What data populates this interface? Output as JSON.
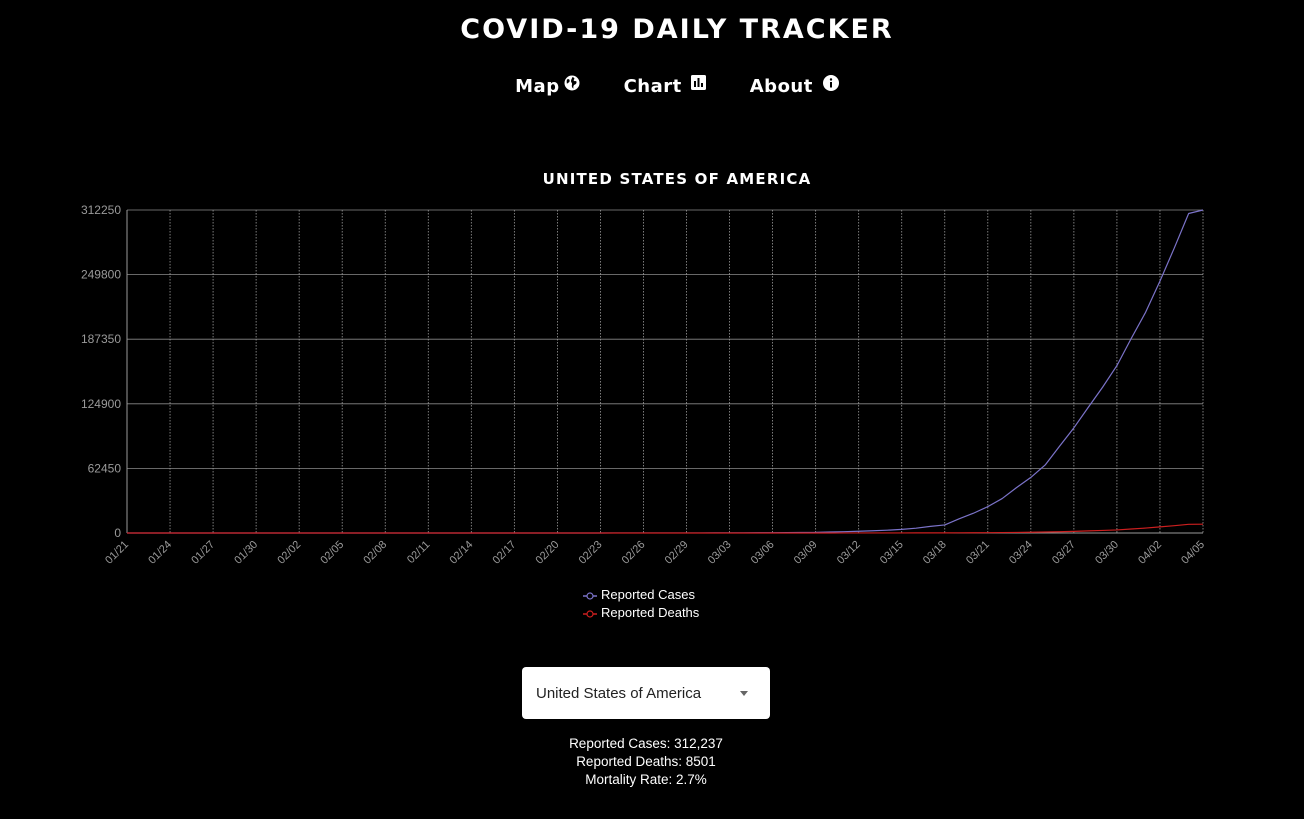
{
  "header": {
    "title": "COVID-19 DAILY TRACKER"
  },
  "nav": {
    "items": [
      {
        "label": "Map",
        "icon": "globe-icon"
      },
      {
        "label": "Chart",
        "icon": "bar-chart-icon"
      },
      {
        "label": "About",
        "icon": "info-icon"
      }
    ]
  },
  "chart_title": "UNITED STATES OF AMERICA",
  "chart_data": {
    "type": "line",
    "title": "UNITED STATES OF AMERICA",
    "xlabel": "",
    "ylabel": "",
    "ylim": [
      0,
      312250
    ],
    "y_ticks": [
      0,
      62450,
      124900,
      187350,
      249800,
      312250
    ],
    "x_tick_labels": [
      "01/21",
      "01/24",
      "01/27",
      "01/30",
      "02/02",
      "02/05",
      "02/08",
      "02/11",
      "02/14",
      "02/17",
      "02/20",
      "02/23",
      "02/26",
      "02/29",
      "03/03",
      "03/06",
      "03/09",
      "03/12",
      "03/15",
      "03/18",
      "03/21",
      "03/24",
      "03/27",
      "03/30",
      "04/02",
      "04/05"
    ],
    "grid": true,
    "legend_placement": "bottom-center",
    "x": [
      "01/21",
      "01/22",
      "01/23",
      "01/24",
      "01/25",
      "01/26",
      "01/27",
      "01/28",
      "01/29",
      "01/30",
      "01/31",
      "02/01",
      "02/02",
      "02/03",
      "02/04",
      "02/05",
      "02/06",
      "02/07",
      "02/08",
      "02/09",
      "02/10",
      "02/11",
      "02/12",
      "02/13",
      "02/14",
      "02/15",
      "02/16",
      "02/17",
      "02/18",
      "02/19",
      "02/20",
      "02/21",
      "02/22",
      "02/23",
      "02/24",
      "02/25",
      "02/26",
      "02/27",
      "02/28",
      "02/29",
      "03/01",
      "03/02",
      "03/03",
      "03/04",
      "03/05",
      "03/06",
      "03/07",
      "03/08",
      "03/09",
      "03/10",
      "03/11",
      "03/12",
      "03/13",
      "03/14",
      "03/15",
      "03/16",
      "03/17",
      "03/18",
      "03/19",
      "03/20",
      "03/21",
      "03/22",
      "03/23",
      "03/24",
      "03/25",
      "03/26",
      "03/27",
      "03/28",
      "03/29",
      "03/30",
      "03/31",
      "04/01",
      "04/02",
      "04/03",
      "04/04",
      "04/05"
    ],
    "series": [
      {
        "name": "Reported Cases",
        "color": "#7b73c9",
        "values": [
          1,
          1,
          1,
          2,
          2,
          5,
          5,
          5,
          5,
          6,
          7,
          8,
          11,
          11,
          11,
          12,
          12,
          12,
          12,
          12,
          13,
          13,
          14,
          14,
          14,
          14,
          14,
          14,
          14,
          14,
          14,
          15,
          15,
          15,
          51,
          51,
          57,
          58,
          60,
          68,
          74,
          98,
          118,
          149,
          217,
          262,
          402,
          518,
          583,
          959,
          1281,
          1663,
          2179,
          2727,
          3499,
          4632,
          6421,
          7786,
          13680,
          19101,
          25493,
          33276,
          43847,
          53740,
          65778,
          83836,
          101657,
          121465,
          140909,
          161831,
          188172,
          213372,
          243453,
          275586,
          308850,
          312237
        ]
      },
      {
        "name": "Reported Deaths",
        "color": "#cc1f1f",
        "values": [
          0,
          0,
          0,
          0,
          0,
          0,
          0,
          0,
          0,
          0,
          0,
          0,
          0,
          0,
          0,
          0,
          0,
          0,
          0,
          0,
          0,
          0,
          0,
          0,
          0,
          0,
          0,
          0,
          0,
          0,
          0,
          0,
          0,
          0,
          0,
          0,
          0,
          0,
          0,
          0,
          1,
          6,
          7,
          11,
          12,
          14,
          17,
          21,
          22,
          28,
          36,
          40,
          47,
          54,
          63,
          85,
          108,
          118,
          200,
          244,
          307,
          427,
          552,
          706,
          942,
          1209,
          1581,
          2026,
          2467,
          2978,
          3873,
          4757,
          5926,
          7087,
          8407,
          8501
        ]
      }
    ]
  },
  "legend": {
    "items": [
      {
        "label": "Reported Cases",
        "color": "#7b73c9"
      },
      {
        "label": "Reported Deaths",
        "color": "#cc1f1f"
      }
    ]
  },
  "country_select": {
    "selected": "United States of America"
  },
  "stats": {
    "cases": "Reported Cases: 312,237",
    "deaths": "Reported Deaths: 8501",
    "mortality": "Mortality Rate: 2.7%"
  }
}
